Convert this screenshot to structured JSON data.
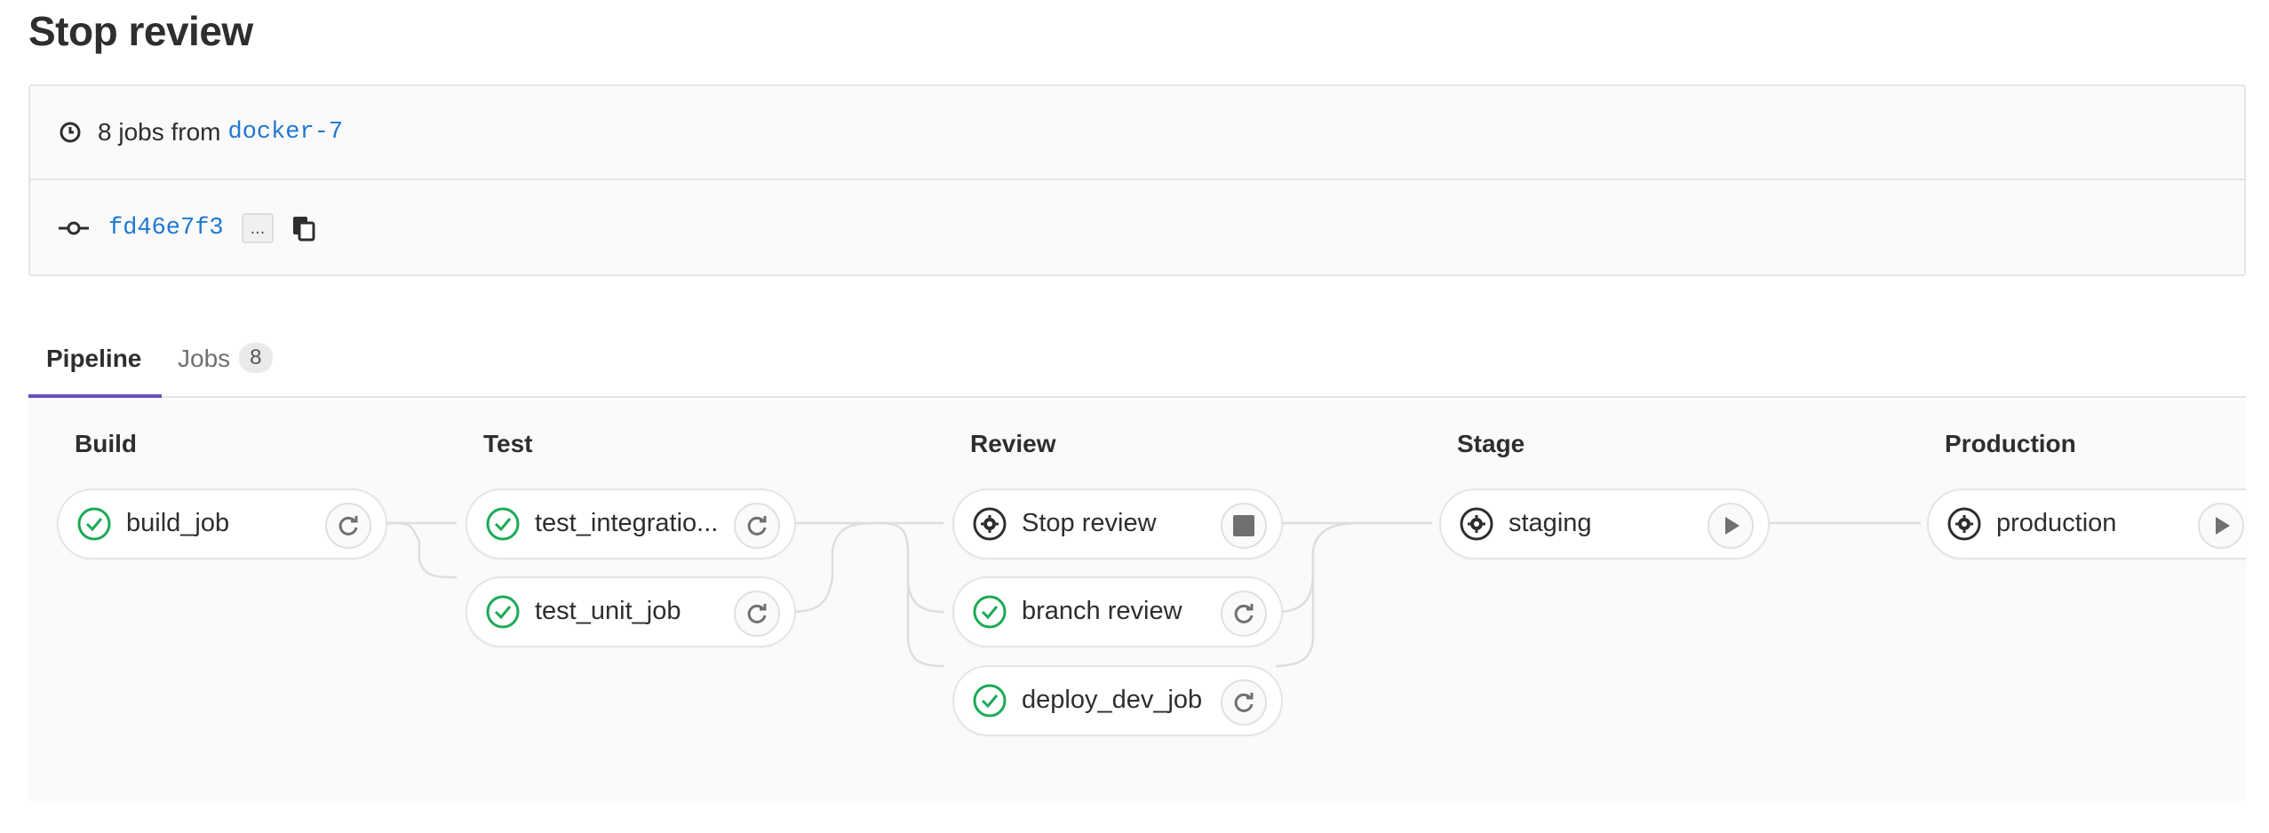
{
  "page": {
    "title": "Stop review"
  },
  "info": {
    "jobs_prefix": "8 jobs from",
    "branch": "docker-7",
    "commit_sha": "fd46e7f3",
    "ellipsis": "..."
  },
  "tabs": [
    {
      "label": "Pipeline",
      "active": true
    },
    {
      "label": "Jobs",
      "badge": "8",
      "active": false
    }
  ],
  "stages": [
    {
      "name": "Build",
      "jobs": [
        {
          "name": "build_job",
          "status": "success",
          "action": "retry"
        }
      ]
    },
    {
      "name": "Test",
      "jobs": [
        {
          "name": "test_integratio...",
          "status": "success",
          "action": "retry"
        },
        {
          "name": "test_unit_job",
          "status": "success",
          "action": "retry"
        }
      ]
    },
    {
      "name": "Review",
      "jobs": [
        {
          "name": "Stop review",
          "status": "manual",
          "action": "stop"
        },
        {
          "name": "branch review",
          "status": "success",
          "action": "retry"
        },
        {
          "name": "deploy_dev_job",
          "status": "success",
          "action": "retry"
        }
      ]
    },
    {
      "name": "Stage",
      "jobs": [
        {
          "name": "staging",
          "status": "manual",
          "action": "play"
        }
      ]
    },
    {
      "name": "Production",
      "jobs": [
        {
          "name": "production",
          "status": "manual",
          "action": "play"
        }
      ]
    }
  ],
  "colors": {
    "success": "#1aaa55",
    "link": "#1f78d1",
    "active_tab": "#6b4fbb"
  }
}
